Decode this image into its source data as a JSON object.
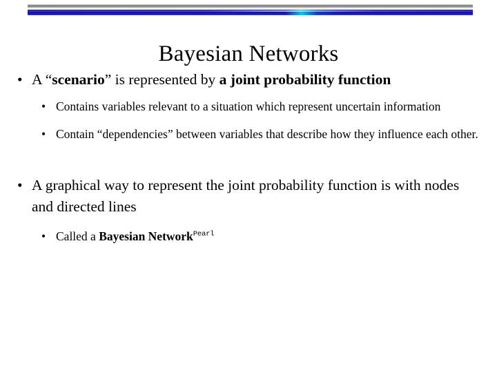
{
  "slide": {
    "background_color": "#ffffff",
    "title": "Bayesian Networks",
    "decoration": {
      "silver_bar_color": "#8f8f8f",
      "blue_bar_color": "#1414b4",
      "highlight_color": "#00e6ff"
    },
    "bullet_glyph": "•",
    "content": [
      {
        "level": 1,
        "name": "bullet-scenario",
        "runs": [
          {
            "text": "A “",
            "bold": false
          },
          {
            "text": "scenario",
            "bold": true
          },
          {
            "text": "” is represented by ",
            "bold": false
          },
          {
            "text": "a joint probability function",
            "bold": true
          }
        ]
      },
      {
        "level": 2,
        "name": "bullet-contains-variables",
        "runs": [
          {
            "text": "Contains variables relevant to a situation which represent uncertain information",
            "bold": false
          }
        ]
      },
      {
        "level": 2,
        "name": "bullet-contain-dependencies",
        "runs": [
          {
            "text": "Contain “dependencies” between variables that describe how they influence each other.",
            "bold": false
          }
        ]
      },
      {
        "level": 1,
        "name": "bullet-graphical-way",
        "runs": [
          {
            "text": "A graphical way to represent the joint probability function is with nodes and directed lines",
            "bold": false
          }
        ]
      },
      {
        "level": 2,
        "name": "bullet-called-bayesian-network",
        "runs": [
          {
            "text": "Called a ",
            "bold": false
          },
          {
            "text": "Bayesian Network",
            "bold": true
          },
          {
            "text": "Pearl",
            "bold": false,
            "superscript": true
          }
        ]
      }
    ]
  }
}
